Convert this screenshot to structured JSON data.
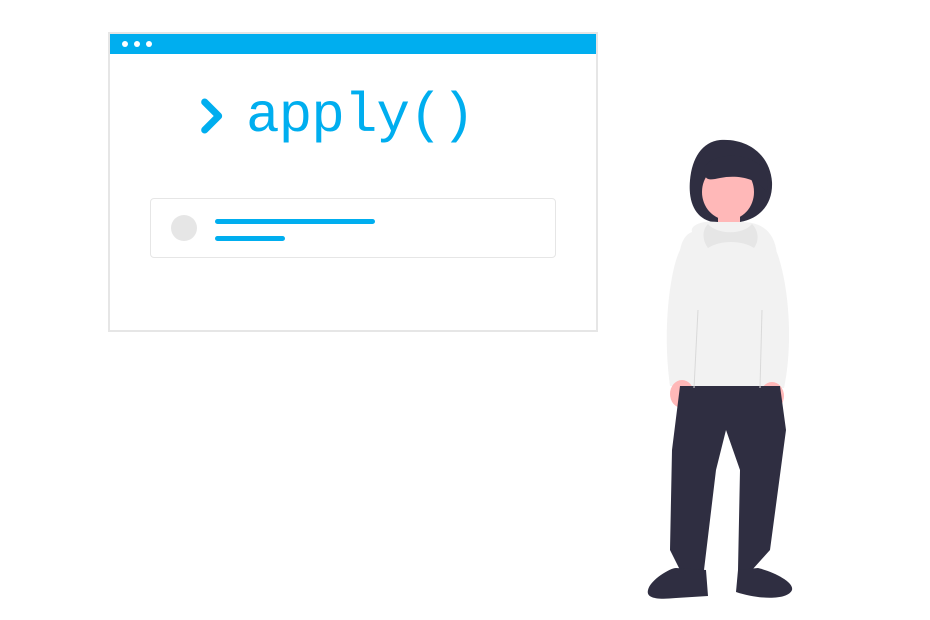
{
  "terminal": {
    "prompt_text": "apply()"
  }
}
